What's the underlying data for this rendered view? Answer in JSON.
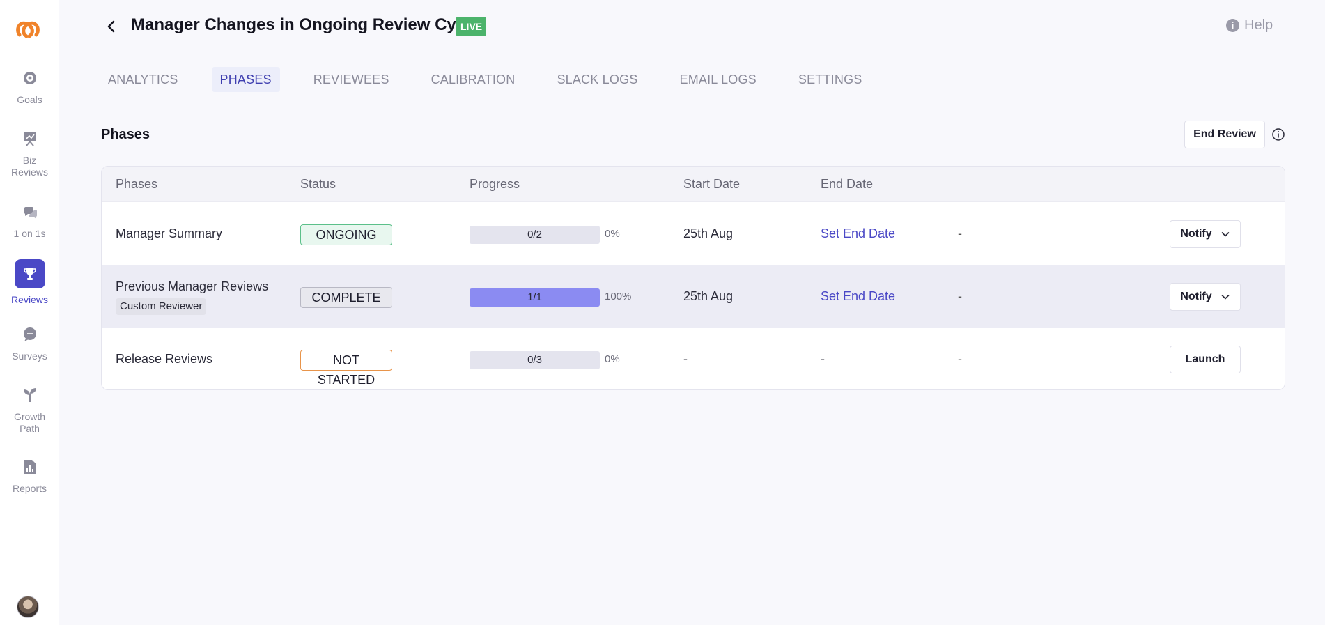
{
  "app": {
    "title": "Manager Changes in Ongoing Review Cycle",
    "live_badge": "LIVE",
    "help_label": "Help"
  },
  "sidebar": {
    "items": [
      {
        "label": "Goals",
        "icon": "target-icon"
      },
      {
        "label": "Biz Reviews",
        "icon": "presentation-icon"
      },
      {
        "label": "1 on 1s",
        "icon": "chat-bubbles-icon"
      },
      {
        "label": "Reviews",
        "icon": "trophy-icon",
        "active": true
      },
      {
        "label": "Surveys",
        "icon": "survey-bubble-icon"
      },
      {
        "label": "Growth Path",
        "icon": "sprout-icon"
      },
      {
        "label": "Reports",
        "icon": "bar-chart-icon"
      }
    ]
  },
  "tabs": [
    {
      "label": "ANALYTICS"
    },
    {
      "label": "PHASES",
      "active": true
    },
    {
      "label": "REVIEWEES"
    },
    {
      "label": "CALIBRATION"
    },
    {
      "label": "SLACK LOGS"
    },
    {
      "label": "EMAIL LOGS"
    },
    {
      "label": "SETTINGS"
    }
  ],
  "section": {
    "title": "Phases",
    "end_review_label": "End Review"
  },
  "table": {
    "headers": [
      "Phases",
      "Status",
      "Progress",
      "Start Date",
      "End Date"
    ],
    "rows": [
      {
        "phase": "Manager Summary",
        "status": "ONGOING",
        "progress_text": "0/2",
        "progress_fraction": 0,
        "percent": "0%",
        "start_date": "25th Aug",
        "end_date": "Set End Date",
        "extra": "-",
        "action": "Notify"
      },
      {
        "phase": "Previous Manager Reviews",
        "tag": "Custom Reviewer",
        "status": "COMPLETE",
        "progress_text": "1/1",
        "progress_fraction": 1,
        "percent": "100%",
        "start_date": "25th Aug",
        "end_date": "Set End Date",
        "extra": "-",
        "action": "Notify"
      },
      {
        "phase": "Release Reviews",
        "status": "NOT STARTED",
        "progress_text": "0/3",
        "progress_fraction": 0,
        "percent": "0%",
        "start_date": "-",
        "end_date": "-",
        "extra": "-",
        "action": "Launch"
      }
    ]
  },
  "colors": {
    "accent": "#4a48c6",
    "live": "#4cb36b",
    "ongoing_bg": "#e8f7ef",
    "ongoing_border": "#5cc08a",
    "complete_bg": "#e8e8ee",
    "complete_border": "#b8b8c4",
    "notstarted_bg": "#ffffff",
    "notstarted_border": "#e8944a",
    "progress_fill": "#8b8bf2"
  }
}
